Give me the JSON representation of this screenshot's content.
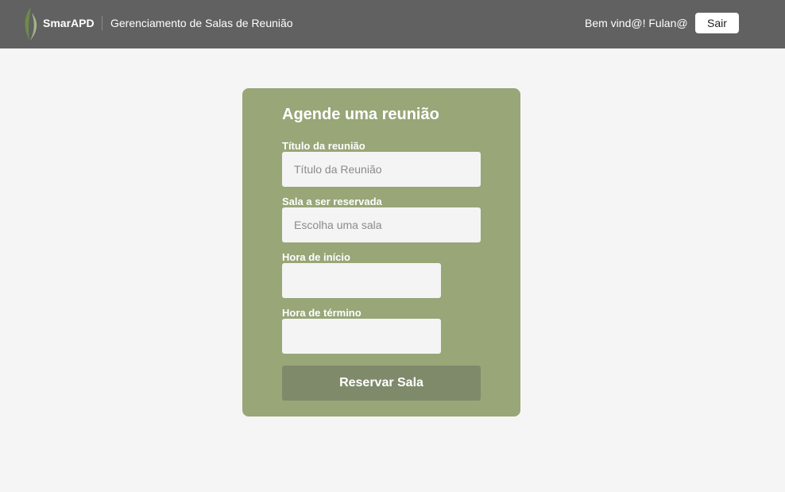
{
  "header": {
    "brand": "SmarAPD",
    "app_title": "Gerenciamento de Salas de Reunião",
    "welcome": "Bem vind@! Fulan@",
    "logout_label": "Sair",
    "logo_icon": "leaf-logo-icon",
    "colors": {
      "background": "#616161",
      "logo_dark": "#5f7a3f",
      "logo_light": "#a8b888"
    }
  },
  "form": {
    "title": "Agende uma reunião",
    "fields": {
      "meeting_title": {
        "label": "Título da reunião",
        "placeholder": "Título da Reunião",
        "value": ""
      },
      "room": {
        "label": "Sala a ser reservada",
        "placeholder": "Escolha uma sala",
        "value": ""
      },
      "start_time": {
        "label": "Hora de início",
        "value": ""
      },
      "end_time": {
        "label": "Hora de término",
        "value": ""
      }
    },
    "submit_label": "Reservar Sala",
    "colors": {
      "card": "#98a678",
      "submit": "#7f8a6a",
      "input": "#f4f4f4"
    }
  },
  "page": {
    "background": "#f5f5f5"
  }
}
